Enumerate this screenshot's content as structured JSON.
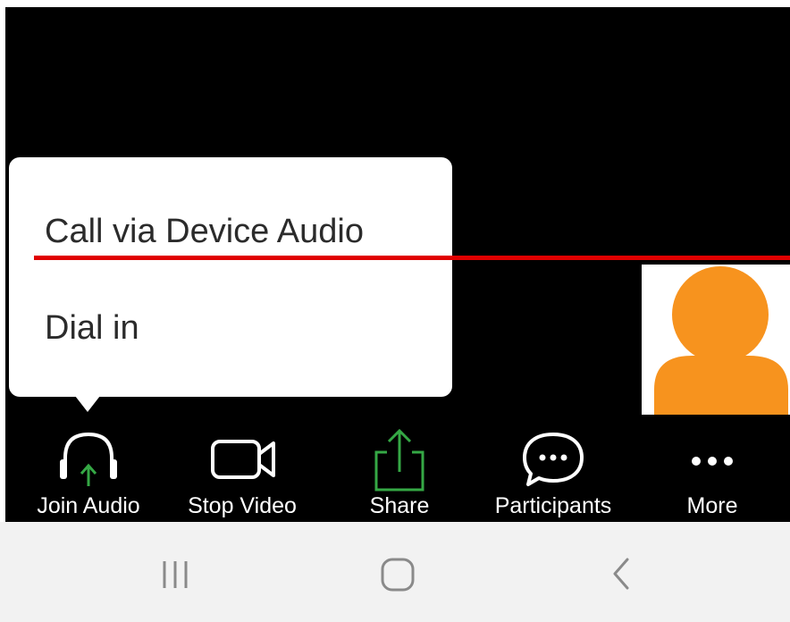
{
  "audio_menu": {
    "options": [
      {
        "label": "Call via Device Audio"
      },
      {
        "label": "Dial in"
      }
    ]
  },
  "toolbar": {
    "items": [
      {
        "label": "Join Audio",
        "icon": "headphones-icon"
      },
      {
        "label": "Stop Video",
        "icon": "video-camera-icon"
      },
      {
        "label": "Share",
        "icon": "share-upload-icon"
      },
      {
        "label": "Participants",
        "icon": "chat-bubble-icon"
      },
      {
        "label": "More",
        "icon": "more-dots-icon"
      }
    ]
  },
  "navbar": {
    "items": [
      {
        "icon": "recent-apps-icon"
      },
      {
        "icon": "home-icon"
      },
      {
        "icon": "back-icon"
      }
    ]
  },
  "colors": {
    "accent_green": "#35a845",
    "highlight_red": "#e00000",
    "avatar_orange": "#f7931e",
    "video_background": "#000000"
  }
}
